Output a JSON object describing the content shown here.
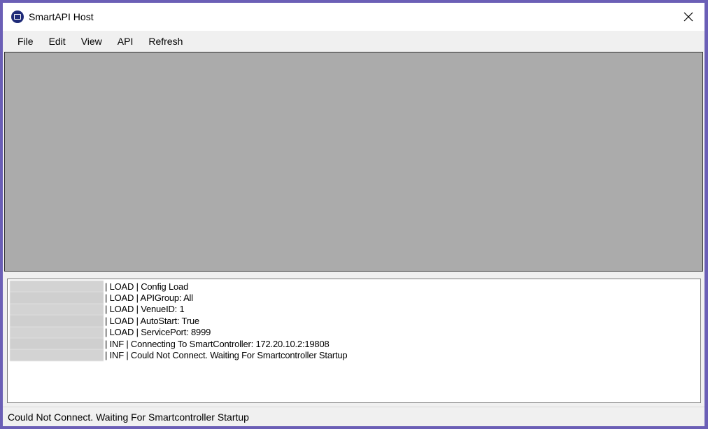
{
  "window": {
    "title": "SmartAPI Host",
    "icon": "app-monitor-icon"
  },
  "menu": {
    "items": [
      {
        "label": "File"
      },
      {
        "label": "Edit"
      },
      {
        "label": "View"
      },
      {
        "label": "API"
      },
      {
        "label": "Refresh"
      }
    ]
  },
  "log": {
    "lines": [
      {
        "text": "| LOAD | Config Load"
      },
      {
        "text": "| LOAD | APIGroup: All"
      },
      {
        "text": "| LOAD | VenueID: 1"
      },
      {
        "text": "| LOAD | AutoStart: True"
      },
      {
        "text": "| LOAD | ServicePort: 8999"
      },
      {
        "text": "| INF | Connecting To SmartController: 172.20.10.2:19808"
      },
      {
        "text": "| INF | Could Not Connect. Waiting For Smartcontroller Startup"
      }
    ]
  },
  "status": {
    "text": "Could Not Connect. Waiting For Smartcontroller Startup"
  },
  "colors": {
    "desktop": "#6b5fb6",
    "canvas": "#ababab",
    "icon": "#1e2a78"
  }
}
